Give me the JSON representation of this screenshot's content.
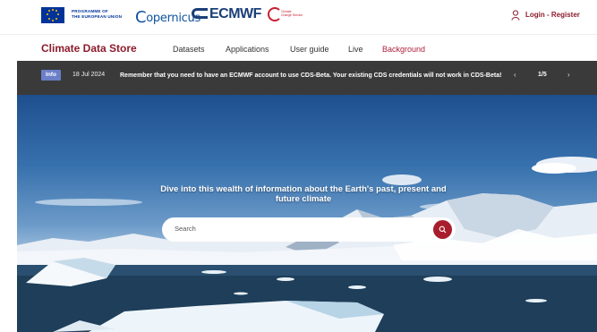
{
  "header": {
    "eu_program": [
      "PROGRAMME OF",
      "THE EUROPEAN UNION"
    ],
    "copernicus": "opernicus",
    "copernicus_c": "C",
    "ecmwf": "ECMWF",
    "climate_change_service": [
      "Climate",
      "Change Service"
    ],
    "login_label": "Login - Register"
  },
  "nav": {
    "brand": "Climate Data Store",
    "items": [
      "Datasets",
      "Applications",
      "User guide",
      "Live",
      "Background"
    ],
    "active_index": 4
  },
  "info": {
    "badge": "Info",
    "date": "18 Jul 2024",
    "message": "Remember that you need to have an ECMWF account to use CDS-Beta. Your existing CDS credentials will not work in CDS-Beta!",
    "prev": "‹",
    "counter": "1/5",
    "next": "›"
  },
  "hero": {
    "tagline": "Dive into this wealth of information about the Earth's past, present and future climate",
    "search_placeholder": "Search"
  },
  "colors": {
    "brand": "#8c1c2c",
    "active_nav": "#b01f3a",
    "info_bar": "#3a3a3a",
    "info_badge": "#6b7fc8",
    "search_button": "#a81d2c"
  },
  "icons": [
    "eu-flag-icon",
    "user-icon",
    "chevron-left-icon",
    "chevron-right-icon",
    "search-icon"
  ]
}
